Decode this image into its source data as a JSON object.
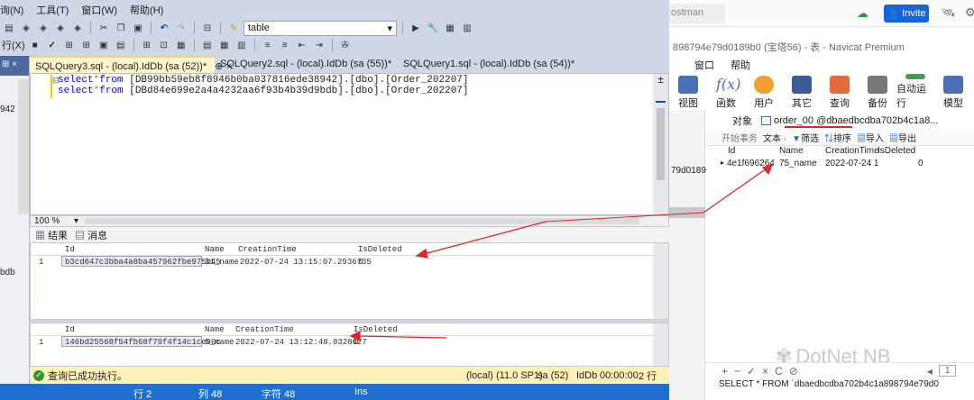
{
  "ssms": {
    "menus": [
      "询(N)",
      "工具(T)",
      "窗口(W)",
      "帮助(H)"
    ],
    "db_selector": "table",
    "row2_partial": "行(X)",
    "objexplorer": {
      "text1": "942",
      "text2": "bdb"
    },
    "doc_tabs": [
      {
        "label": "SQLQuery3.sql - (local).IdDb (sa (52))*",
        "pin": "⊕ ×"
      },
      {
        "label": "SQLQuery2.sql - (local).IdDb (sa (55))*"
      },
      {
        "label": "SQLQuery1.sql - (local).IdDb (sa (54))*"
      }
    ],
    "editor": {
      "lines": [
        {
          "kw1": "select",
          "op": "*",
          "kw2": "from",
          "obj": "[DB99bb59eb8f8946b0ba037816ede38942]",
          "rest": ".[dbo].[Order_202207]"
        },
        {
          "kw1": "select",
          "op": "*",
          "kw2": "from",
          "obj": "[DBd84e699e2a4a4232aa6f93b4b39d9bdb]",
          "rest": ".[dbo].[Order_202207]"
        }
      ]
    },
    "zoom": "100 %",
    "result_tabs": {
      "results": "结果",
      "messages": "消息"
    },
    "grid1": {
      "columns": [
        "Id",
        "Name",
        "CreationTime",
        "IsDeleted"
      ],
      "row": {
        "num": "1",
        "id": "b3cd647c3bba4a8ba457962fbe975b45",
        "name": "31_name",
        "time": "2022-07-24 13:15:07.2936735",
        "deleted": "0"
      }
    },
    "grid2": {
      "columns": [
        "Id",
        "Name",
        "CreationTime",
        "IsDeleted"
      ],
      "row": {
        "num": "1",
        "id": "146bd25568f54fb68f79f4f14c1ce80c",
        "name": "5_name",
        "time": "2022-07-24 13:12:48.8328627",
        "deleted": "0"
      }
    },
    "status": {
      "message": "查询已成功执行。",
      "server": "(local) (11.0 SP1)",
      "user": "sa (52)",
      "db": "IdDb",
      "time": "00:00:00",
      "rows": "2 行"
    },
    "bottom": {
      "line": "行 2",
      "col": "列 48",
      "char": "字符 48",
      "mode": "Ins"
    }
  },
  "navicat": {
    "search_text": "ostman",
    "invite_label": "Invite",
    "title": "898794e79d0189b0 (宝塔56) - 表 - Navicat Premium",
    "menus": [
      "窗口",
      "帮助"
    ],
    "buttons": [
      "视图",
      "函数",
      "用户",
      "其它",
      "查询",
      "备份",
      "自动运行",
      "模型"
    ],
    "left_text": "79d0189",
    "tabs": {
      "objects": "对象",
      "table_tab": "order_00 @dbaedbcdba702b4c1a8..."
    },
    "toolbar": [
      "开始事务",
      "文本 ·",
      "筛选",
      "排序",
      "导入",
      "导出"
    ],
    "grid": {
      "columns": [
        "Id",
        "Name",
        "CreationTime",
        "IsDeleted"
      ],
      "row": {
        "id": "4e1f696264",
        "name": "75_name",
        "time": "2022-07-24 1",
        "deleted": "0"
      }
    },
    "bottom_controls": [
      "+",
      "−",
      "✓",
      "×",
      "C",
      "⊘"
    ],
    "page_num": "1",
    "sql_text": "SELECT * FROM `dbaedbcdba702b4c1a898794e79d0",
    "watermark": "DotNet NB"
  }
}
